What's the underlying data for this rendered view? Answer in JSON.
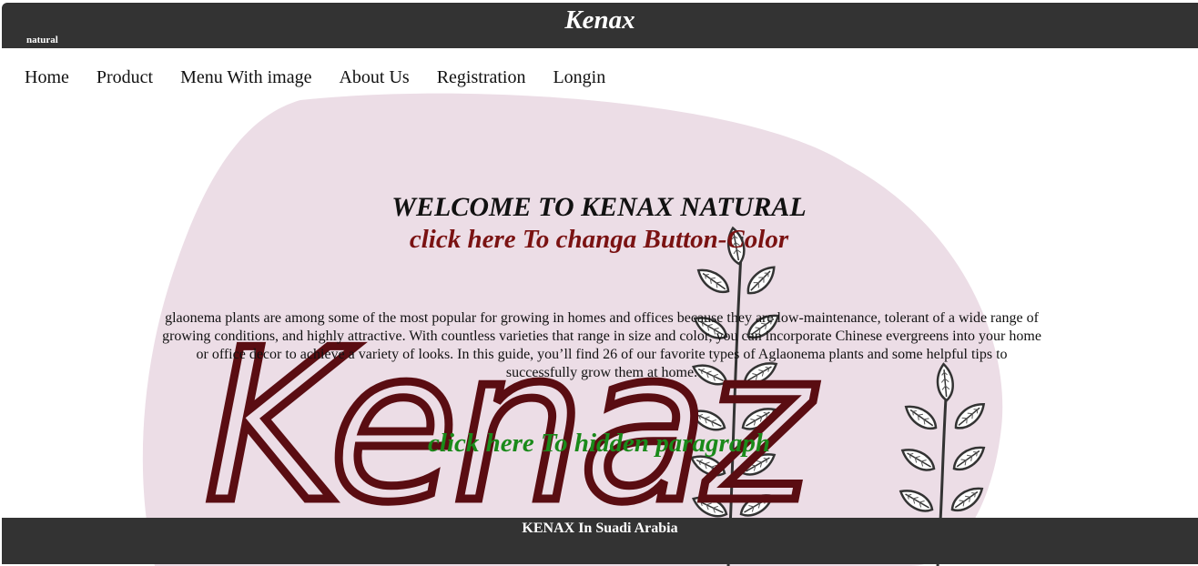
{
  "header": {
    "title": "Kenax",
    "subtitle": "natural"
  },
  "nav": {
    "items": [
      {
        "label": "Home"
      },
      {
        "label": "Product"
      },
      {
        "label": "Menu With image"
      },
      {
        "label": "About Us"
      },
      {
        "label": "Registration"
      },
      {
        "label": "Longin"
      }
    ]
  },
  "main": {
    "welcome": "WELCOME TO KENAX NATURAL",
    "color_button_label": "click here To changa Button-Color",
    "paragraph": "glaonema plants are among some of the most popular for growing in homes and offices because they are low-maintenance, tolerant of a wide range of growing conditions, and highly attractive. With countless varieties that range in size and color, you can incorporate Chinese evergreens into your home or office decor to achieve a variety of looks. In this guide, you’ll find 26 of our favorite types of Aglaonema plants and some helpful tips to successfully grow them at home.",
    "hide_button_label": "click here To hidden paragraph",
    "background_logo_text": "Kenaz"
  },
  "footer": {
    "text": "KENAX In Suadi Arabia"
  },
  "colors": {
    "bar": "#333333",
    "accent_red": "#7a1212",
    "accent_green": "#1a8a1a",
    "blob": "#ecdde6",
    "logo_text": "#5a0d12"
  }
}
